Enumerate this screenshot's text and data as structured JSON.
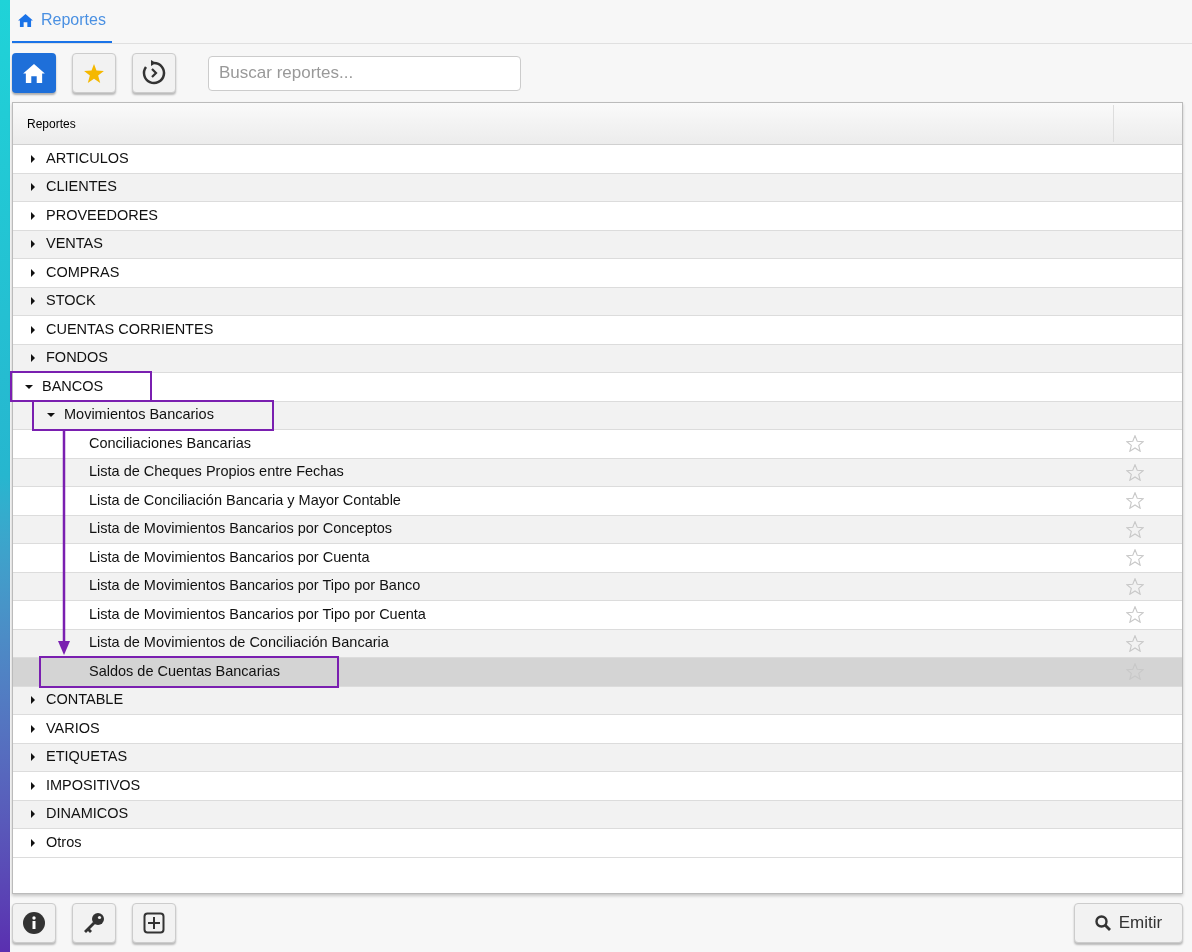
{
  "tab": {
    "label": "Reportes",
    "selected": true
  },
  "search": {
    "placeholder": "Buscar reportes..."
  },
  "table": {
    "header": "Reportes"
  },
  "tree": [
    {
      "label": "ARTICULOS",
      "expanded": false
    },
    {
      "label": "CLIENTES",
      "expanded": false
    },
    {
      "label": "PROVEEDORES",
      "expanded": false
    },
    {
      "label": "VENTAS",
      "expanded": false
    },
    {
      "label": "COMPRAS",
      "expanded": false
    },
    {
      "label": "STOCK",
      "expanded": false
    },
    {
      "label": "CUENTAS CORRIENTES",
      "expanded": false
    },
    {
      "label": "FONDOS",
      "expanded": false
    },
    {
      "label": "BANCOS",
      "expanded": true,
      "annotated": true,
      "children": [
        {
          "label": "Movimientos Bancarios",
          "expanded": true,
          "annotated": true,
          "children": [
            {
              "label": "Conciliaciones Bancarias",
              "favorite": false,
              "selected": false
            },
            {
              "label": "Lista de Cheques Propios entre Fechas",
              "favorite": false,
              "selected": false
            },
            {
              "label": "Lista de Conciliación Bancaria y Mayor Contable",
              "favorite": false,
              "selected": false
            },
            {
              "label": "Lista de Movimientos Bancarios por Conceptos",
              "favorite": false,
              "selected": false
            },
            {
              "label": "Lista de Movimientos Bancarios por Cuenta",
              "favorite": false,
              "selected": false
            },
            {
              "label": "Lista de Movimientos Bancarios por Tipo por Banco",
              "favorite": false,
              "selected": false
            },
            {
              "label": "Lista de Movimientos Bancarios por Tipo por Cuenta",
              "favorite": false,
              "selected": false
            },
            {
              "label": "Lista de Movimientos de Conciliación Bancaria",
              "favorite": false,
              "selected": false
            },
            {
              "label": "Saldos de Cuentas Bancarias",
              "favorite": false,
              "selected": true,
              "annotated": true
            }
          ]
        }
      ]
    },
    {
      "label": "CONTABLE",
      "expanded": false
    },
    {
      "label": "VARIOS",
      "expanded": false
    },
    {
      "label": "ETIQUETAS",
      "expanded": false
    },
    {
      "label": "IMPOSITIVOS",
      "expanded": false
    },
    {
      "label": "DINAMICOS",
      "expanded": false
    },
    {
      "label": "Otros",
      "expanded": false
    }
  ],
  "emit_button": "Emitir"
}
